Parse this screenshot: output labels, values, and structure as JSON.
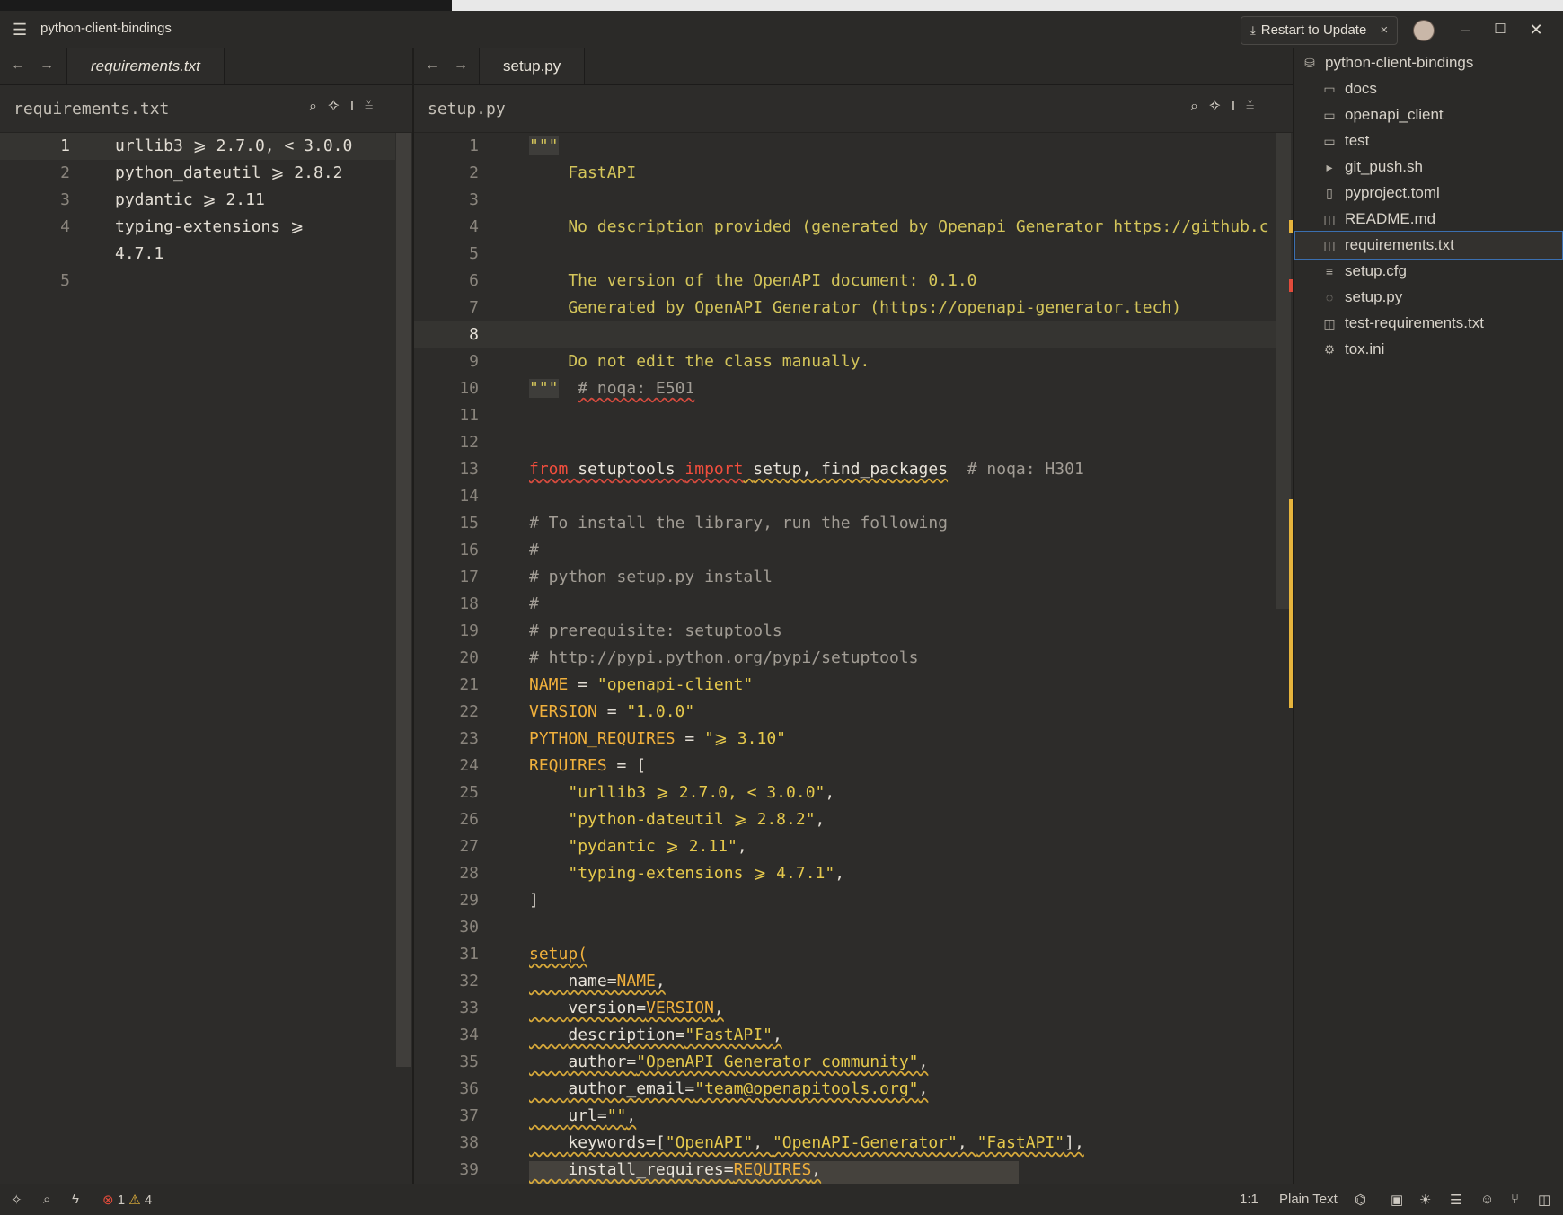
{
  "window": {
    "project_title": "python-client-bindings",
    "restart_label": "Restart to Update"
  },
  "left_pane": {
    "tab_label": "requirements.txt",
    "breadcrumb": "requirements.txt",
    "lines": [
      {
        "n": "1",
        "text": "urllib3 ⩾ 2.7.0, < 3.0.0"
      },
      {
        "n": "2",
        "text": "python_dateutil ⩾ 2.8.2"
      },
      {
        "n": "3",
        "text": "pydantic ⩾ 2.11"
      },
      {
        "n": "4",
        "text": "typing-extensions ⩾"
      },
      {
        "n": "",
        "text": "4.7.1"
      },
      {
        "n": "5",
        "text": ""
      }
    ]
  },
  "right_pane": {
    "tab_label": "setup.py",
    "breadcrumb": "setup.py",
    "line_numbers": [
      "1",
      "2",
      "3",
      "4",
      "5",
      "6",
      "7",
      "8",
      "9",
      "10",
      "11",
      "12",
      "13",
      "14",
      "15",
      "16",
      "17",
      "18",
      "19",
      "20",
      "21",
      "22",
      "23",
      "24",
      "25",
      "26",
      "27",
      "28",
      "29",
      "30",
      "31",
      "32",
      "33",
      "34",
      "35",
      "36",
      "37",
      "38",
      "39"
    ],
    "code": {
      "l1": "\"\"\"",
      "l2": "    FastAPI",
      "l4": "    No description provided (generated by Openapi Generator https://github.c",
      "l6": "    The version of the OpenAPI document: 0.1.0",
      "l7": "    Generated by OpenAPI Generator (https://openapi-generator.tech)",
      "l9": "    Do not edit the class manually.",
      "l10a": "\"\"\"",
      "l10b": "# noqa: E501",
      "l13_from": "from",
      "l13_mod": "setuptools",
      "l13_import": "import",
      "l13_names": "setup, find_packages",
      "l13_cmt": "# noqa: H301",
      "l15": "# To install the library, run the following",
      "l16": "#",
      "l17": "# python setup.py install",
      "l18": "#",
      "l19": "# prerequisite: setuptools",
      "l20": "# http://pypi.python.org/pypi/setuptools",
      "l21_name": "NAME",
      "l21_val": "\"openapi-client\"",
      "l22_name": "VERSION",
      "l22_val": "\"1.0.0\"",
      "l23_name": "PYTHON_REQUIRES",
      "l23_val": "\"⩾ 3.10\"",
      "l24_name": "REQUIRES",
      "l24_rest": " = [",
      "l25": "\"urllib3 ⩾ 2.7.0, < 3.0.0\"",
      "l26": "\"python-dateutil ⩾ 2.8.2\"",
      "l27": "\"pydantic ⩾ 2.11\"",
      "l28": "\"typing-extensions ⩾ 4.7.1\"",
      "l29": "]",
      "l31": "setup(",
      "l32_k": "name=",
      "l32_v": "NAME",
      "l33_k": "version=",
      "l33_v": "VERSION",
      "l34_k": "description=",
      "l34_v": "\"FastAPI\"",
      "l35_k": "author=",
      "l35_v": "\"OpenAPI Generator community\"",
      "l36_k": "author_email=",
      "l36_v": "\"team@openapitools.org\"",
      "l37_k": "url=",
      "l37_v": "\"\"",
      "l38_k": "keywords=[",
      "l38_v1": "\"OpenAPI\"",
      "l38_v2": "\"OpenAPI-Generator\"",
      "l38_v3": "\"FastAPI\"",
      "l38_end": "],",
      "l39_k": "install_requires=",
      "l39_v": "REQUIRES"
    }
  },
  "project_panel": {
    "root": "python-client-bindings",
    "items": [
      {
        "label": "docs",
        "icon": "folder-icon"
      },
      {
        "label": "openapi_client",
        "icon": "folder-icon"
      },
      {
        "label": "test",
        "icon": "folder-icon"
      },
      {
        "label": "git_push.sh",
        "icon": "terminal-icon"
      },
      {
        "label": "pyproject.toml",
        "icon": "toml-icon"
      },
      {
        "label": "README.md",
        "icon": "book-icon"
      },
      {
        "label": "requirements.txt",
        "icon": "book-icon"
      },
      {
        "label": "setup.cfg",
        "icon": "lines-icon"
      },
      {
        "label": "setup.py",
        "icon": "python-icon"
      },
      {
        "label": "test-requirements.txt",
        "icon": "book-icon"
      },
      {
        "label": "tox.ini",
        "icon": "gear-icon"
      }
    ]
  },
  "status_bar": {
    "errors": "1",
    "warnings": "4",
    "cursor": "1:1",
    "language": "Plain Text"
  },
  "colors": {
    "accent_selection": "#3b6fb0",
    "error": "#e24b3b",
    "warning": "#e6b43c"
  }
}
